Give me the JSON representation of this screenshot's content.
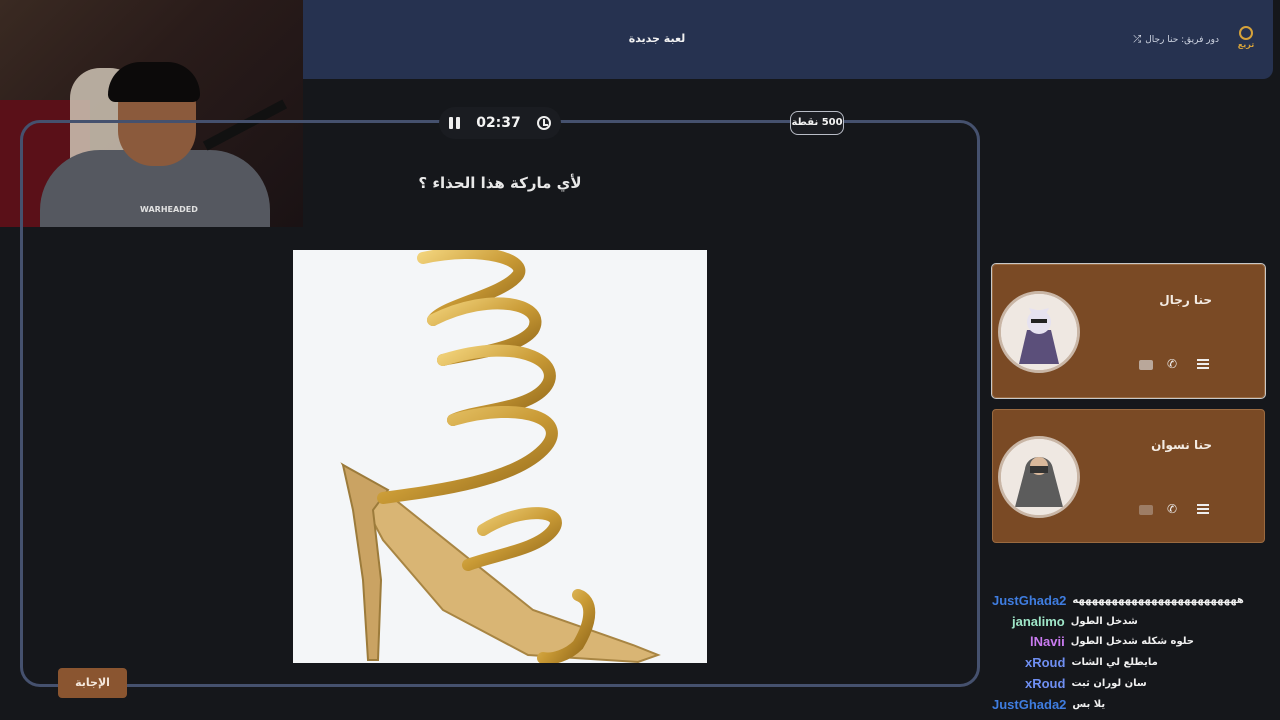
{
  "header": {
    "title": "لعبة جديدة",
    "turn_label": "دور فريق: حنا رجال",
    "logo_text": "تريع"
  },
  "game": {
    "timer": "02:37",
    "points": "500 نقطة",
    "question": "لأي ماركة هذا الحذاء ؟",
    "answer_button": "الإجابة"
  },
  "webcam": {
    "hoodie_text": "WARHEADED"
  },
  "teams": [
    {
      "name": "حنا رجال",
      "active": true
    },
    {
      "name": "حنا نسوان",
      "active": false
    }
  ],
  "chat": [
    {
      "user": "JustGhada2",
      "color": "#3f7de0",
      "message": "هههههههههههههههههههههههههه"
    },
    {
      "user": "janalimo",
      "color": "#9fe6c8",
      "message": "شدخل الطول"
    },
    {
      "user": "lNavii",
      "color": "#c97bf0",
      "message": "حلوه شكله شدخل الطول"
    },
    {
      "user": "xRoud",
      "color": "#6f8ff2",
      "message": "مايطلع لي الشات"
    },
    {
      "user": "xRoud",
      "color": "#6f8ff2",
      "message": "سان لوران ثبت"
    },
    {
      "user": "JustGhada2",
      "color": "#3f7de0",
      "message": "يلا بس"
    }
  ],
  "icons": {
    "pause": "pause-icon",
    "history": "history-icon",
    "shuffle": "shuffle-icon",
    "phone": "phone-icon",
    "list": "list-icon",
    "flag": "flag-icon"
  }
}
